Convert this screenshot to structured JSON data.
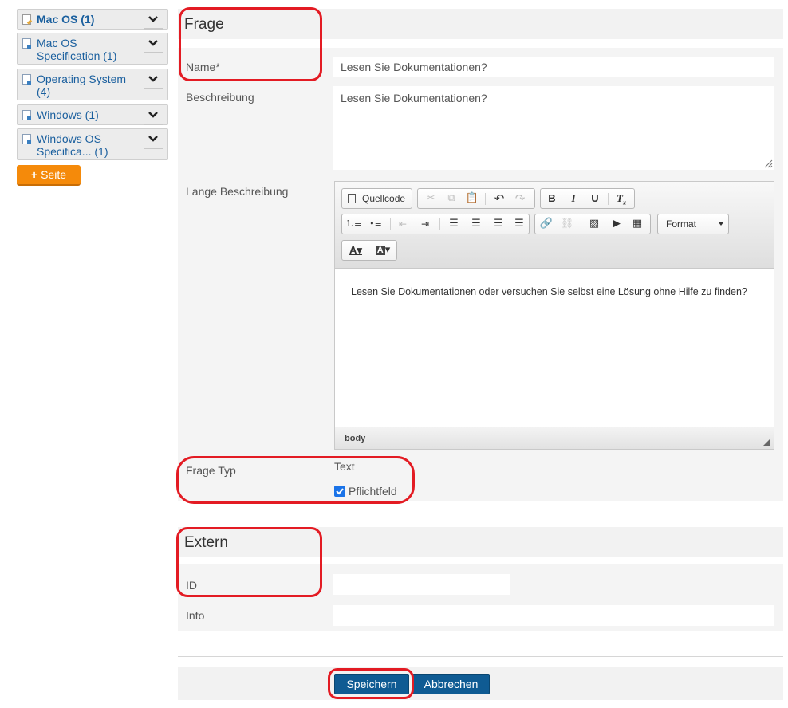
{
  "sidebar": {
    "items": [
      {
        "label": "Mac OS (1)",
        "bold": true
      },
      {
        "label_line1": "Mac OS",
        "label_line2": "Specification (1)"
      },
      {
        "label_line1": "Operating System",
        "label_line2": "(4)"
      },
      {
        "label": "Windows (1)"
      },
      {
        "label_line1": "Windows OS",
        "label_line2": "Specifica... (1)"
      }
    ],
    "add_page_label": "Seite"
  },
  "frage": {
    "title": "Frage",
    "name_label": "Name*",
    "name_value": "Lesen Sie Dokumentationen?",
    "beschreibung_label": "Beschreibung",
    "beschreibung_value": "Lesen Sie Dokumentationen?",
    "lange_label": "Lange Beschreibung",
    "editor": {
      "source_label": "Quellcode",
      "format_label": "Format",
      "content": "Lesen Sie Dokumentationen oder versuchen Sie selbst eine Lösung ohne Hilfe zu finden?",
      "status_path": "body"
    },
    "typ_label": "Frage Typ",
    "typ_value": "Text",
    "pflicht_label": "Pflichtfeld"
  },
  "extern": {
    "title": "Extern",
    "id_label": "ID",
    "id_value": "",
    "info_label": "Info",
    "info_value": ""
  },
  "actions": {
    "save_label": "Speichern",
    "cancel_label": "Abbrechen"
  },
  "colors": {
    "accent": "#0f5b93",
    "add_button": "#f58a0a",
    "annotation": "#e31b23"
  }
}
